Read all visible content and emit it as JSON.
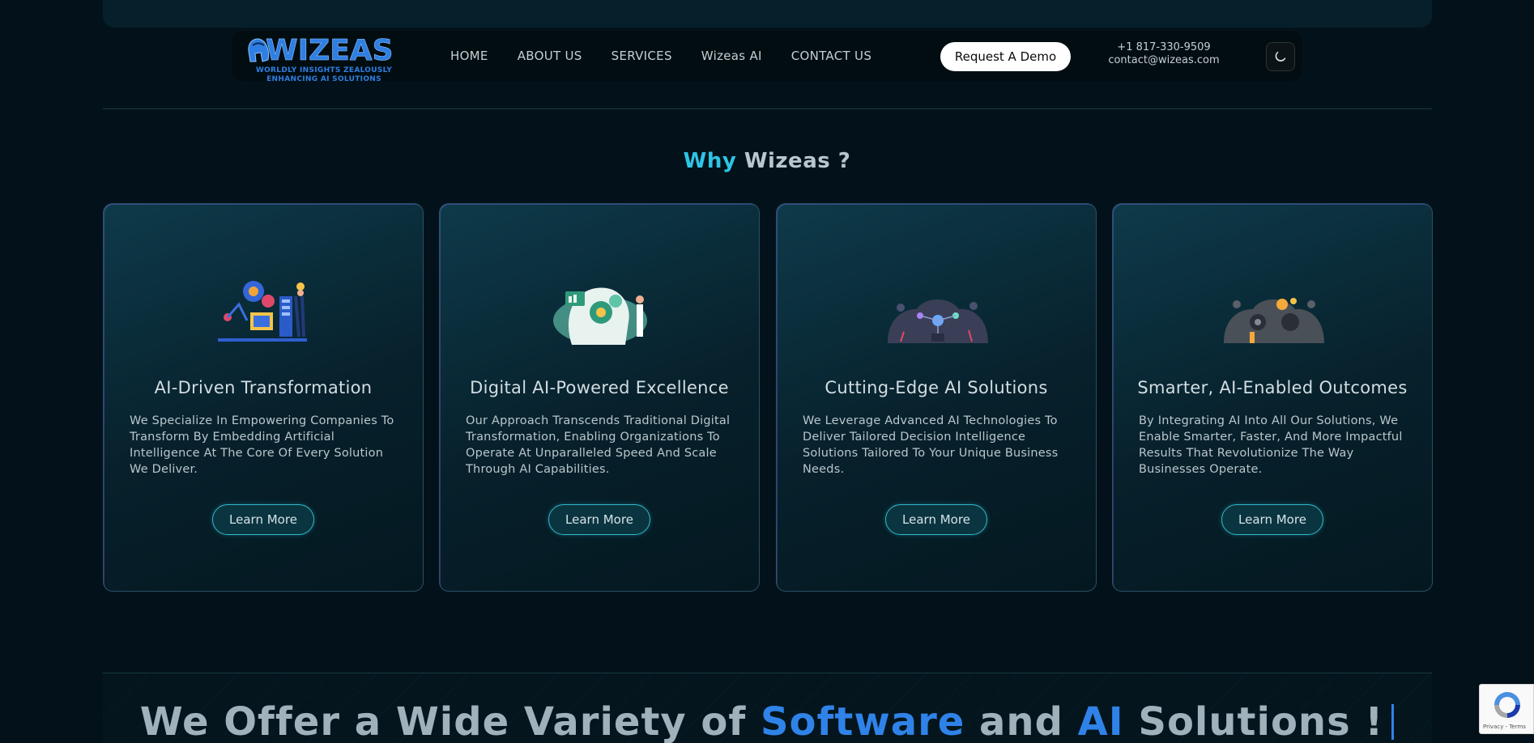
{
  "nav": {
    "logo_word": "WIZEAS",
    "logo_tagline_1": "WORLDLY INSIGHTS ZEALOUSLY",
    "logo_tagline_2": "ENHANCING AI SOLUTIONS",
    "links": [
      "HOME",
      "ABOUT US",
      "SERVICES",
      "Wizeas AI",
      "CONTACT US"
    ],
    "demo_button": "Request A Demo",
    "phone": "+1 817-330-9509",
    "email": "contact@wizeas.com",
    "theme_icon": "moon-icon"
  },
  "why": {
    "title_accent": "Why",
    "title_rest": " Wizeas ?",
    "cards": [
      {
        "title": "AI-Driven Transformation",
        "description": "We Specialize In Empowering Companies To Transform By Embedding Artificial Intelligence At The Core Of Every Solution We Deliver.",
        "button": "Learn More",
        "illustration": "ai-engineering-illustration"
      },
      {
        "title": "Digital AI-Powered Excellence",
        "description": "Our Approach Transcends Traditional Digital Transformation, Enabling Organizations To Operate At Unparalleled Speed And Scale Through AI Capabilities.",
        "button": "Learn More",
        "illustration": "ai-head-gears-illustration"
      },
      {
        "title": "Cutting-Edge AI Solutions",
        "description": "We Leverage Advanced AI Technologies To Deliver Tailored Decision Intelligence Solutions Tailored To Your Unique Business Needs.",
        "button": "Learn More",
        "illustration": "ai-network-illustration"
      },
      {
        "title": "Smarter, AI-Enabled Outcomes",
        "description": "By Integrating AI Into All Our Solutions, We Enable Smarter, Faster, And More Impactful Results That Revolutionize The Way Businesses Operate.",
        "button": "Learn More",
        "illustration": "ai-brain-outcomes-illustration"
      }
    ]
  },
  "headline": {
    "part1": "We Offer a Wide Variety of ",
    "software": "Software",
    "and": " and ",
    "ai": "AI",
    "part2": " Solutions !"
  },
  "recaptcha": {
    "links": "Privacy - Terms"
  },
  "colors": {
    "background": "#03121a",
    "accent_cyan": "#2ec4e6",
    "accent_blue": "#2f83e8"
  }
}
